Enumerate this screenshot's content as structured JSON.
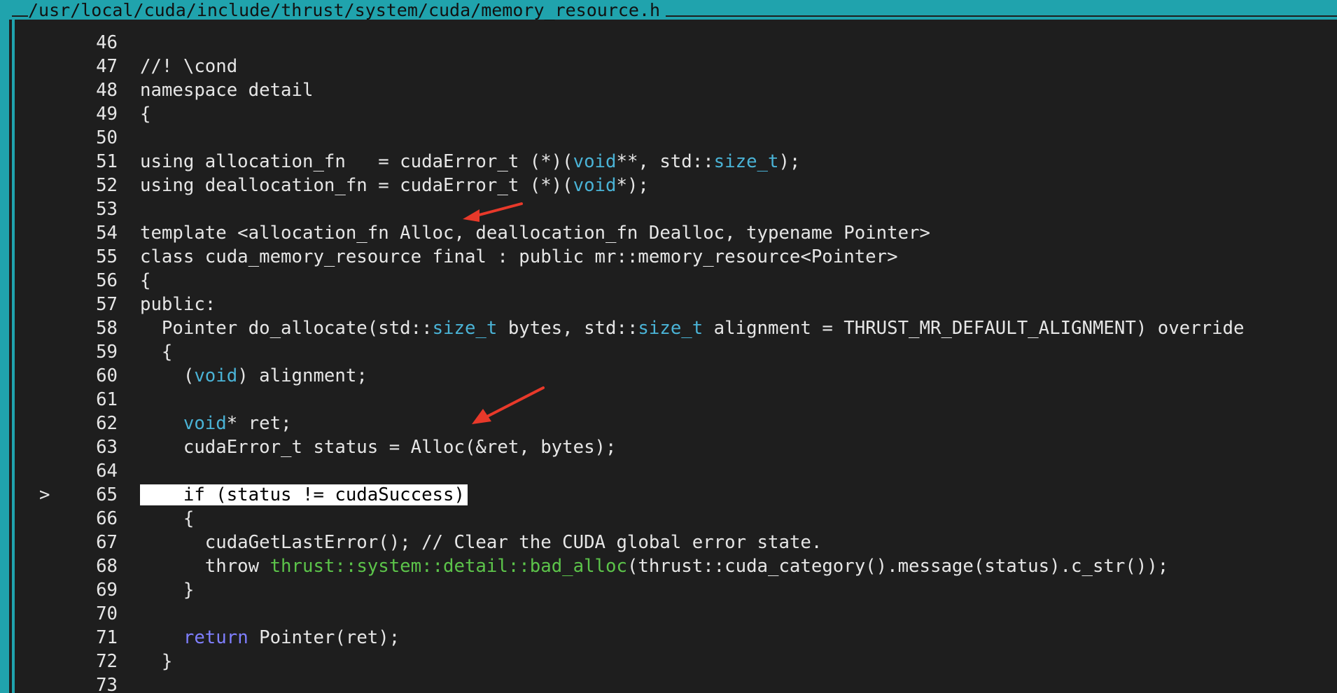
{
  "title": "/usr/local/cuda/include/thrust/system/cuda/memory_resource.h",
  "colors": {
    "background": "#1e1e1e",
    "frame": "#20a3ad",
    "text": "#e6e6e6",
    "type": "#4ab3d6",
    "namespace": "#5cc44a",
    "keyword": "#7f7fff",
    "highlight_bg": "#ffffff",
    "highlight_fg": "#000000",
    "arrow": "#e8392a"
  },
  "current_line_marker": ">",
  "lines": [
    {
      "num": "46",
      "tokens": []
    },
    {
      "num": "47",
      "tokens": [
        {
          "t": "//! \\cond",
          "c": ""
        }
      ]
    },
    {
      "num": "48",
      "tokens": [
        {
          "t": "namespace detail",
          "c": ""
        }
      ]
    },
    {
      "num": "49",
      "tokens": [
        {
          "t": "{",
          "c": ""
        }
      ]
    },
    {
      "num": "50",
      "tokens": []
    },
    {
      "num": "51",
      "tokens": [
        {
          "t": "using allocation_fn   = cudaError_t (*)(",
          "c": ""
        },
        {
          "t": "void",
          "c": "type"
        },
        {
          "t": "**, std::",
          "c": ""
        },
        {
          "t": "size_t",
          "c": "type"
        },
        {
          "t": ");",
          "c": ""
        }
      ]
    },
    {
      "num": "52",
      "tokens": [
        {
          "t": "using deallocation_fn = cudaError_t (*)(",
          "c": ""
        },
        {
          "t": "void",
          "c": "type"
        },
        {
          "t": "*);",
          "c": ""
        }
      ]
    },
    {
      "num": "53",
      "tokens": []
    },
    {
      "num": "54",
      "tokens": [
        {
          "t": "template <allocation_fn Alloc, deallocation_fn Dealloc, typename Pointer>",
          "c": ""
        }
      ]
    },
    {
      "num": "55",
      "tokens": [
        {
          "t": "class cuda_memory_resource final : public mr::memory_resource<Pointer>",
          "c": ""
        }
      ]
    },
    {
      "num": "56",
      "tokens": [
        {
          "t": "{",
          "c": ""
        }
      ]
    },
    {
      "num": "57",
      "tokens": [
        {
          "t": "public:",
          "c": ""
        }
      ]
    },
    {
      "num": "58",
      "tokens": [
        {
          "t": "  Pointer do_allocate(std::",
          "c": ""
        },
        {
          "t": "size_t",
          "c": "type"
        },
        {
          "t": " bytes, std::",
          "c": ""
        },
        {
          "t": "size_t",
          "c": "type"
        },
        {
          "t": " alignment = THRUST_MR_DEFAULT_ALIGNMENT) override",
          "c": ""
        }
      ]
    },
    {
      "num": "59",
      "tokens": [
        {
          "t": "  {",
          "c": ""
        }
      ]
    },
    {
      "num": "60",
      "tokens": [
        {
          "t": "    (",
          "c": ""
        },
        {
          "t": "void",
          "c": "type"
        },
        {
          "t": ") alignment;",
          "c": ""
        }
      ]
    },
    {
      "num": "61",
      "tokens": []
    },
    {
      "num": "62",
      "tokens": [
        {
          "t": "    ",
          "c": ""
        },
        {
          "t": "void",
          "c": "type"
        },
        {
          "t": "* ret;",
          "c": ""
        }
      ]
    },
    {
      "num": "63",
      "tokens": [
        {
          "t": "    cudaError_t status = Alloc(&ret, bytes);",
          "c": ""
        }
      ]
    },
    {
      "num": "64",
      "tokens": []
    },
    {
      "num": "65",
      "current": true,
      "tokens": [
        {
          "t": "    if (status != cudaSuccess)",
          "c": "hl"
        }
      ]
    },
    {
      "num": "66",
      "tokens": [
        {
          "t": "    {",
          "c": ""
        }
      ]
    },
    {
      "num": "67",
      "tokens": [
        {
          "t": "      cudaGetLastError(); // Clear the CUDA global error state.",
          "c": ""
        }
      ]
    },
    {
      "num": "68",
      "tokens": [
        {
          "t": "      throw ",
          "c": ""
        },
        {
          "t": "thrust::system::detail::bad_alloc",
          "c": "ns"
        },
        {
          "t": "(thrust::cuda_category().message(status).c_str());",
          "c": ""
        }
      ]
    },
    {
      "num": "69",
      "tokens": [
        {
          "t": "    }",
          "c": ""
        }
      ]
    },
    {
      "num": "70",
      "tokens": []
    },
    {
      "num": "71",
      "tokens": [
        {
          "t": "    ",
          "c": ""
        },
        {
          "t": "return",
          "c": "kw"
        },
        {
          "t": " Pointer(ret);",
          "c": ""
        }
      ]
    },
    {
      "num": "72",
      "tokens": [
        {
          "t": "  }",
          "c": ""
        }
      ]
    },
    {
      "num": "73",
      "tokens": []
    }
  ]
}
